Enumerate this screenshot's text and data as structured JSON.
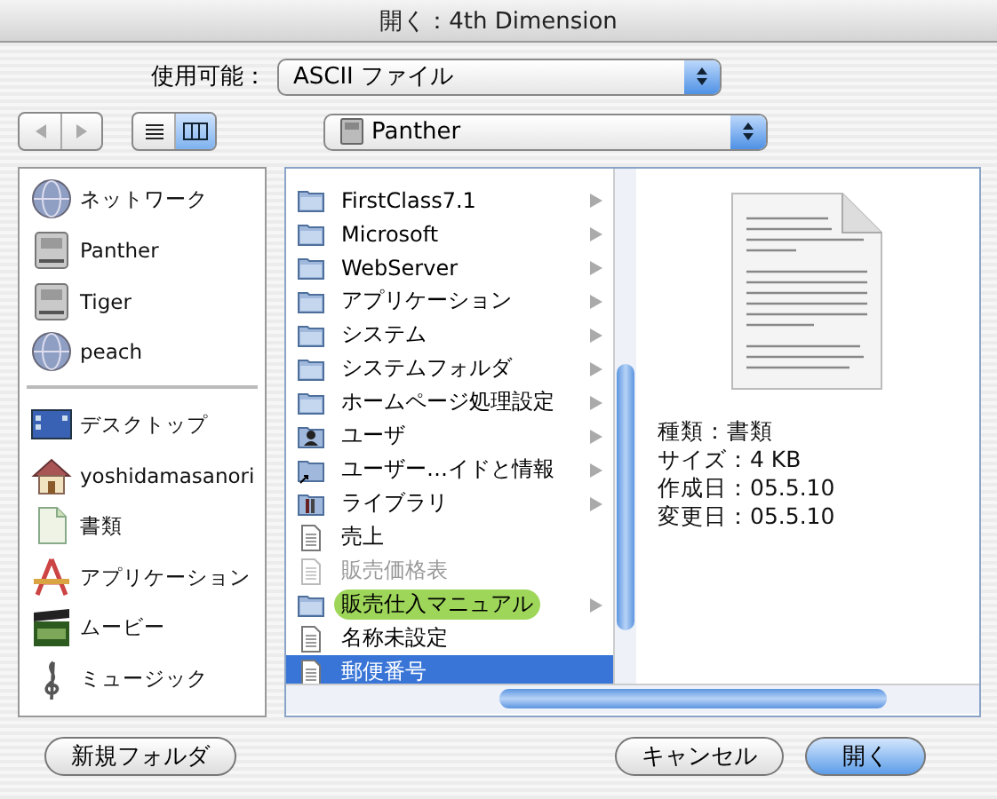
{
  "window": {
    "title": "開く：4th Dimension"
  },
  "format": {
    "label": "使用可能：",
    "value": "ASCII ファイル"
  },
  "navigation": {
    "back_disabled": true,
    "forward_disabled": true
  },
  "view_modes": [
    {
      "kind": "list",
      "selected": false
    },
    {
      "kind": "column",
      "selected": true
    }
  ],
  "location": {
    "value": "Panther"
  },
  "sidebar": {
    "devices": [
      {
        "kind": "network",
        "label": "ネットワーク"
      },
      {
        "kind": "disk",
        "label": "Panther"
      },
      {
        "kind": "disk",
        "label": "Tiger"
      },
      {
        "kind": "network",
        "label": "peach"
      }
    ],
    "places": [
      {
        "kind": "desktop",
        "label": "デスクトップ"
      },
      {
        "kind": "home",
        "label": "yoshidamasanori"
      },
      {
        "kind": "documents",
        "label": "書類"
      },
      {
        "kind": "applications",
        "label": "アプリケーション"
      },
      {
        "kind": "movies",
        "label": "ムービー"
      },
      {
        "kind": "music",
        "label": "ミュージック"
      }
    ]
  },
  "files": [
    {
      "kind": "folder",
      "label": "FirstClass7.1",
      "has_children": true,
      "disabled": false,
      "selected": false
    },
    {
      "kind": "folder",
      "label": "Microsoft",
      "has_children": true,
      "disabled": false,
      "selected": false
    },
    {
      "kind": "folder",
      "label": "WebServer",
      "has_children": true,
      "disabled": false,
      "selected": false
    },
    {
      "kind": "folder",
      "label": "アプリケーション",
      "has_children": true,
      "disabled": false,
      "selected": false
    },
    {
      "kind": "folder",
      "label": "システム",
      "has_children": true,
      "disabled": false,
      "selected": false
    },
    {
      "kind": "folder",
      "label": "システムフォルダ",
      "has_children": true,
      "disabled": false,
      "selected": false
    },
    {
      "kind": "folder",
      "label": "ホームページ処理設定",
      "has_children": true,
      "disabled": false,
      "selected": false
    },
    {
      "kind": "user-folder",
      "label": "ユーザ",
      "has_children": true,
      "disabled": false,
      "selected": false
    },
    {
      "kind": "alias-folder",
      "label": "ユーザー…イドと情報",
      "has_children": true,
      "disabled": false,
      "selected": false
    },
    {
      "kind": "library-folder",
      "label": "ライブラリ",
      "has_children": true,
      "disabled": false,
      "selected": false
    },
    {
      "kind": "document",
      "label": "売上",
      "has_children": false,
      "disabled": false,
      "selected": false
    },
    {
      "kind": "document",
      "label": "販売価格表",
      "has_children": false,
      "disabled": true,
      "selected": false
    },
    {
      "kind": "folder",
      "label": "販売仕入マニュアル",
      "has_children": true,
      "disabled": false,
      "selected": false,
      "color": "#9ed65a"
    },
    {
      "kind": "document",
      "label": "名称未設定",
      "has_children": false,
      "disabled": false,
      "selected": false
    },
    {
      "kind": "document",
      "label": "郵便番号",
      "has_children": false,
      "disabled": false,
      "selected": true
    }
  ],
  "preview": {
    "info": [
      "種類：書類",
      "サイズ：4 KB",
      "作成日：05.5.10",
      "変更日：05.5.10"
    ]
  },
  "buttons": [
    {
      "kind": "secondary",
      "label": "新規フォルダ"
    },
    {
      "kind": "secondary",
      "label": "キャンセル"
    },
    {
      "kind": "default",
      "label": "開く"
    }
  ]
}
